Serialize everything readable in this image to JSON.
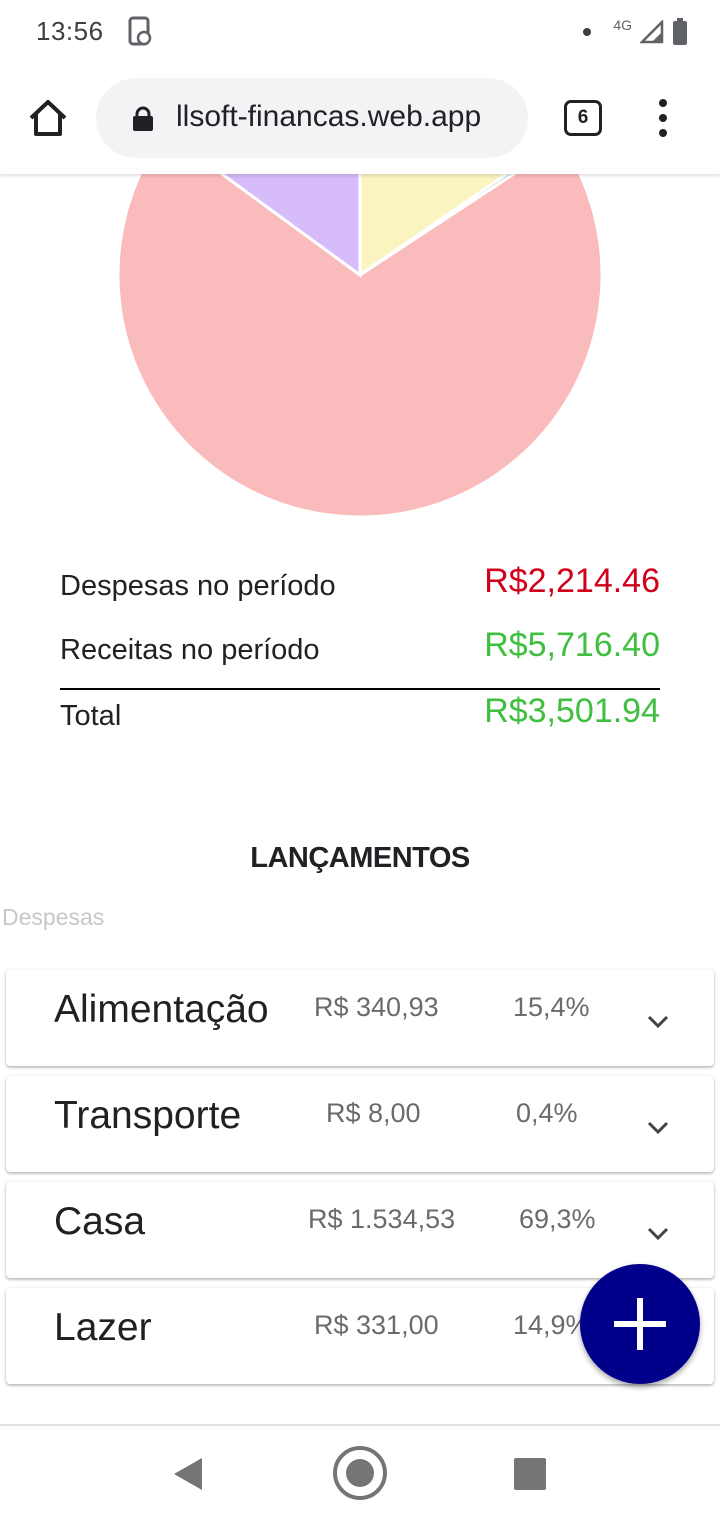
{
  "status_bar": {
    "time": "13:56",
    "network": "4G"
  },
  "browser": {
    "url": "llsoft-financas.web.app",
    "tab_count": "6"
  },
  "chart_data": {
    "type": "pie",
    "slices": [
      {
        "label": "Alimentação",
        "value": 340.93,
        "color": "#faf5c0"
      },
      {
        "label": "Transporte",
        "value": 8.0,
        "color": "#b7e0c2"
      },
      {
        "label": "Casa",
        "value": 1534.53,
        "color": "#f9bbbb"
      },
      {
        "label": "Lazer",
        "value": 331.0,
        "color": "#d6bcf9"
      }
    ]
  },
  "summary": {
    "expenses_label": "Despesas no período",
    "expenses_value": "R$2,214.46",
    "income_label": "Receitas no período",
    "income_value": "R$5,716.40",
    "total_label": "Total",
    "total_value": "R$3,501.94",
    "colors": {
      "negative": "#d0021b",
      "positive": "#3fbf3f"
    }
  },
  "section": {
    "title": "LANÇAMENTOS",
    "subtitle": "Despesas"
  },
  "categories": [
    {
      "name": "Alimentação",
      "amount": "R$ 340,93",
      "percent": "15,4%"
    },
    {
      "name": "Transporte",
      "amount": "R$ 8,00",
      "percent": "0,4%"
    },
    {
      "name": "Casa",
      "amount": "R$ 1.534,53",
      "percent": "69,3%"
    },
    {
      "name": "Lazer",
      "amount": "R$ 331,00",
      "percent": "14,9%"
    }
  ],
  "fab": {
    "icon": "plus-icon",
    "color": "#00008b"
  }
}
